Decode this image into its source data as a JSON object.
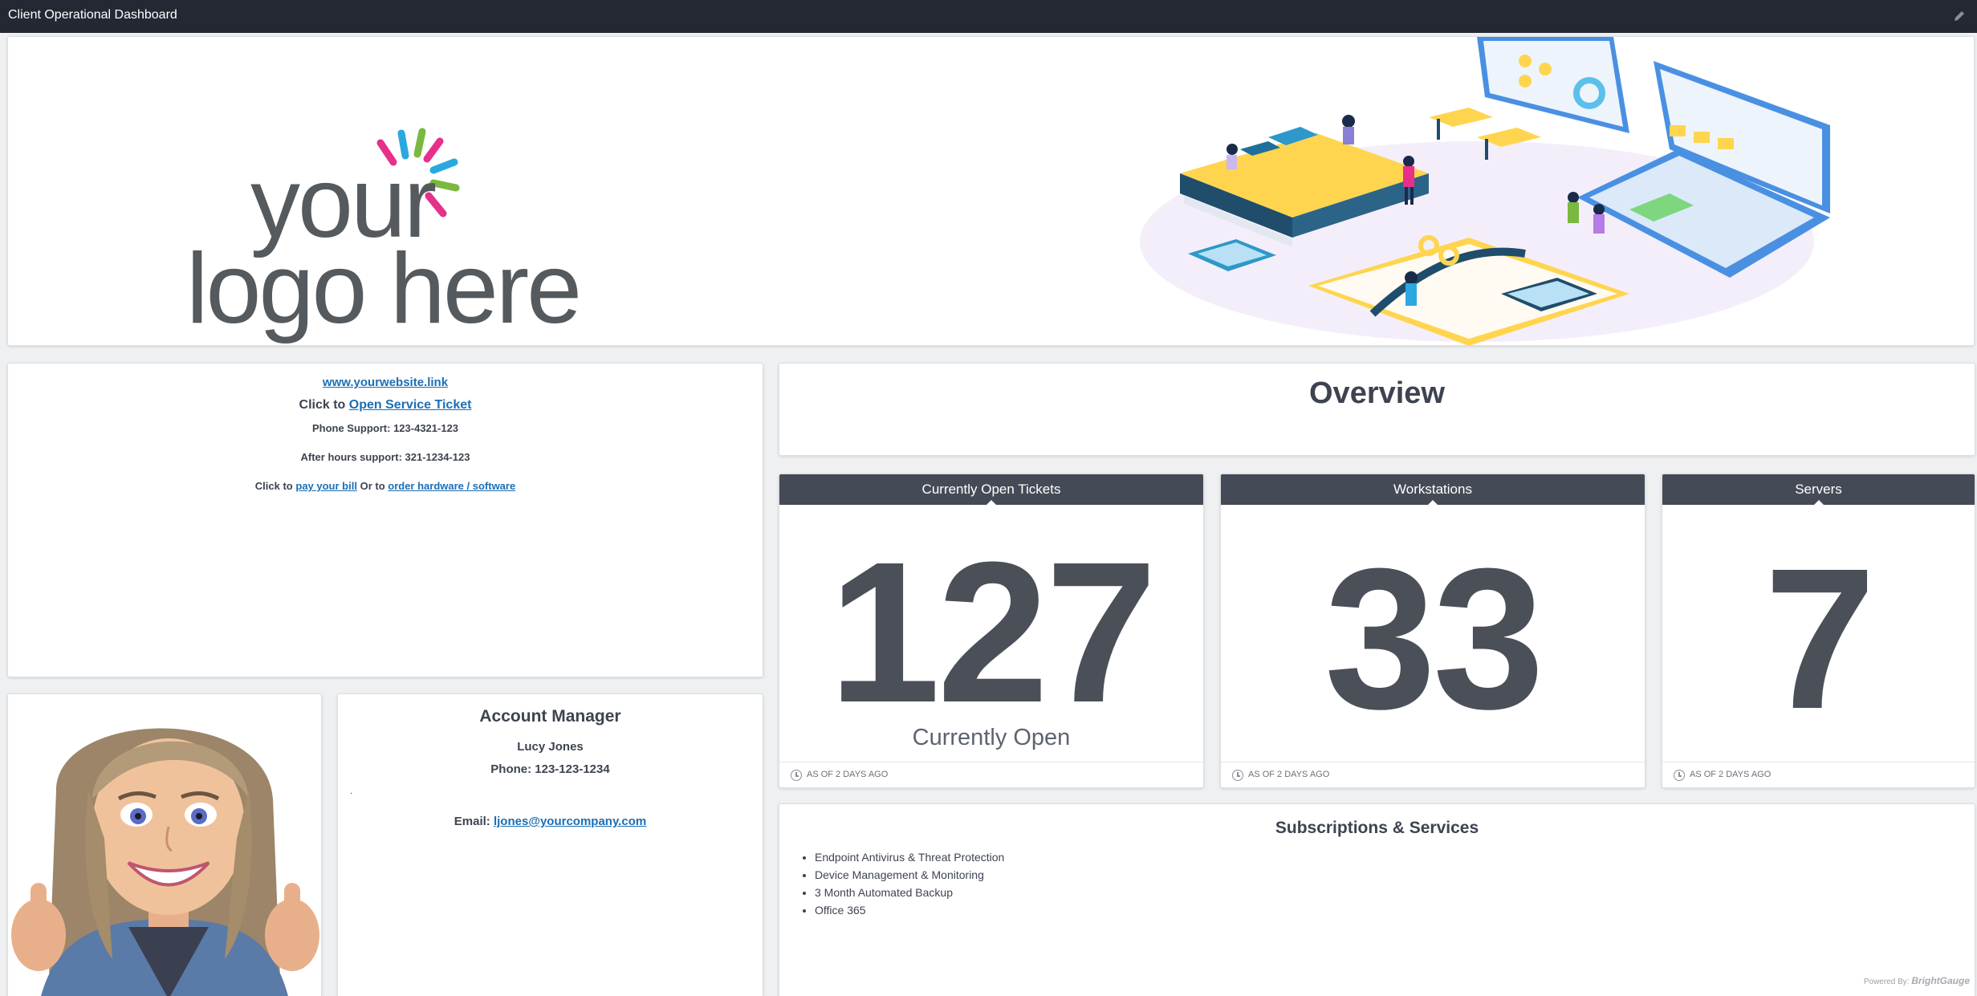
{
  "topbar": {
    "title": "Client Operational Dashboard",
    "edit_icon": "pencil-icon"
  },
  "banner": {
    "logo_line1": "your",
    "logo_line2": "logo here",
    "logo_ray_colors": [
      "#e6308a",
      "#2aa9e0",
      "#7ab840",
      "#f15bb5",
      "#2aa9e0",
      "#7ab840",
      "#e6308a"
    ]
  },
  "links_card": {
    "website": "www.yourwebsite.link",
    "click_to": "Click to",
    "open_ticket": "Open Service Ticket",
    "phone_support": "Phone Support: 123-4321-123",
    "after_hours": "After hours support: 321-1234-123",
    "click_to_2": "Click to",
    "pay_bill": "pay your bill",
    "or_to": "Or to",
    "order_hw": "order hardware / software"
  },
  "overview": {
    "title": "Overview"
  },
  "gauges": [
    {
      "title": "Currently Open Tickets",
      "value": "127",
      "subtitle": "Currently Open",
      "footer": "AS OF 2 DAYS AGO"
    },
    {
      "title": "Workstations",
      "value": "33",
      "subtitle": "",
      "footer": "AS OF 2 DAYS AGO"
    },
    {
      "title": "Servers",
      "value": "7",
      "subtitle": "",
      "footer": "AS OF 2 DAYS AGO"
    }
  ],
  "account_manager": {
    "heading": "Account Manager",
    "name": "Lucy Jones",
    "phone": "Phone: 123-123-1234",
    "dot": ".",
    "email_label": "Email:",
    "email": "ljones@yourcompany.com"
  },
  "subscriptions": {
    "title": "Subscriptions & Services",
    "items": [
      "Endpoint Antivirus & Threat Protection",
      "Device Management & Monitoring",
      "3 Month Automated Backup",
      "Office 365"
    ]
  },
  "footer": {
    "powered_by": "Powered By:",
    "brand": "BrightGauge"
  },
  "colors": {
    "topbar": "#232833",
    "gauge_header": "#454b56",
    "link": "#1b6fb5"
  }
}
